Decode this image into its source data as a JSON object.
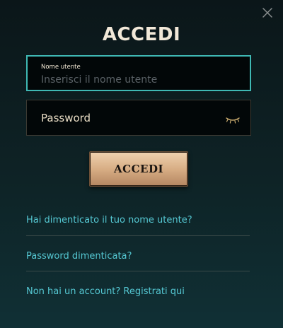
{
  "dialog": {
    "title": "ACCEDI"
  },
  "username": {
    "label": "Nome utente",
    "placeholder": "Inserisci il nome utente",
    "value": ""
  },
  "password": {
    "label": "Password"
  },
  "submit_label": "ACCEDI",
  "links": {
    "forgot_username": "Hai dimenticato il tuo nome utente?",
    "forgot_password": "Password dimenticata?",
    "register": "Non hai un account? Registrati qui"
  },
  "colors": {
    "accent_teal": "#3fb8b4",
    "link": "#55c8d3",
    "gold": "#d8ae85",
    "text_light": "#f2e8d8"
  },
  "icons": {
    "close": "close-icon",
    "show_password": "eye-closed-icon"
  }
}
